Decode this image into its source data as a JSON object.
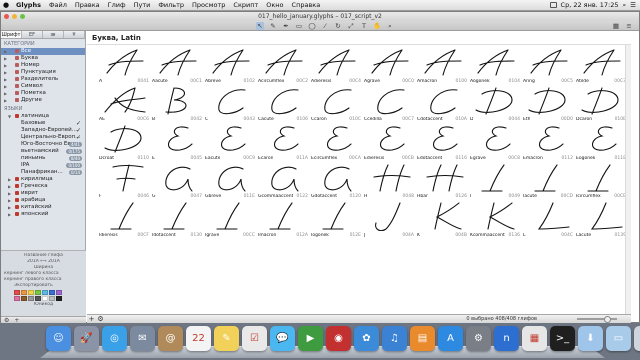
{
  "menubar": {
    "apple_icon": "apple-icon",
    "menus": [
      "Glyphs",
      "Файл",
      "Правка",
      "Глиф",
      "Пути",
      "Фильтр",
      "Просмотр",
      "Скрипт",
      "Окно",
      "Справка"
    ],
    "clock": "Ср, 22 янв. 17:25"
  },
  "window": {
    "title": "017_hello_january.glyphs – 017_script_v2",
    "toolbar_icons": [
      "pointer-tool",
      "draw-tool",
      "pen-tool",
      "rectangle-tool",
      "ellipse-tool",
      "knife-tool",
      "rotate-tool",
      "scale-tool",
      "text-tool",
      "hand-tool",
      "zoom-tool"
    ]
  },
  "sidebar": {
    "tabs": [
      "Шрифт",
      "ЕF",
      "ᴂ",
      "¥"
    ],
    "categories_heading": "КАТЕГОРИИ",
    "categories": [
      {
        "label": "Все",
        "selected": true
      },
      {
        "label": "Буква"
      },
      {
        "label": "Номер"
      },
      {
        "label": "Пунктуация"
      },
      {
        "label": "Разделитель"
      },
      {
        "label": "Символ"
      },
      {
        "label": "Пометка"
      },
      {
        "label": "Другие"
      }
    ],
    "languages_heading": "ЯЗЫКИ",
    "languages": [
      {
        "label": "латиница",
        "level": 1
      },
      {
        "label": "Базовые",
        "level": 2,
        "check": true
      },
      {
        "label": "Западно-Европей...",
        "level": 2,
        "check": true
      },
      {
        "label": "Центрально-Европ...",
        "level": 2,
        "check": true
      },
      {
        "label": "Юго-Восточно Евр...",
        "level": 2,
        "badge": "4/41"
      },
      {
        "label": "вьетнамский",
        "level": 2,
        "badge": "0/175"
      },
      {
        "label": "пиньинь",
        "level": 2,
        "badge": "8/40"
      },
      {
        "label": "IPA",
        "level": 2,
        "badge": "0/100"
      },
      {
        "label": "Панафрикан...",
        "level": 2,
        "badge": "0/14"
      },
      {
        "label": "кириллица",
        "level": 1
      },
      {
        "label": "Греческа",
        "level": 1
      },
      {
        "label": "иврит",
        "level": 1
      },
      {
        "label": "арабица",
        "level": 1
      },
      {
        "label": "китайский",
        "level": 1
      },
      {
        "label": "японский",
        "level": 1
      }
    ],
    "bottom": {
      "glyph_name_label": "Название глифа",
      "unicode_row": "201A ⟷ 201A",
      "width_label": "Ширина",
      "kerning_left": "кернинг левого класса",
      "kerning_right": "кернинг правого класса",
      "export_label": "Экспортировать",
      "note_label": "Юникод",
      "swatch_colors": [
        "#e54b4b",
        "#f0973a",
        "#f3d54a",
        "#7ac943",
        "#5fb9e5",
        "#3a6fd8",
        "#a066d3",
        "#e06ea8",
        "#8b5a2b",
        "#9a9a9a",
        "#555555",
        "#ffffff",
        "#c0c0c0",
        "#222222"
      ]
    }
  },
  "main": {
    "header": "Буква, Latin",
    "status": "0 выбрано 408/408 глифов",
    "glyphs": [
      {
        "name": "A",
        "code": "0041",
        "shape": "A"
      },
      {
        "name": "Aacute",
        "code": "00C1",
        "shape": "A"
      },
      {
        "name": "Abreve",
        "code": "0102",
        "shape": "A"
      },
      {
        "name": "Acircumflex",
        "code": "00C2",
        "shape": "A"
      },
      {
        "name": "Adieresis",
        "code": "00C4",
        "shape": "A"
      },
      {
        "name": "Agrave",
        "code": "00C0",
        "shape": "A"
      },
      {
        "name": "Amacron",
        "code": "0100",
        "shape": "A"
      },
      {
        "name": "Aogonek",
        "code": "0104",
        "shape": "A"
      },
      {
        "name": "Aring",
        "code": "00C5",
        "shape": "A"
      },
      {
        "name": "Atilde",
        "code": "00C3",
        "shape": "A"
      },
      {
        "name": "AE",
        "code": "00C6",
        "shape": "AE"
      },
      {
        "name": "B",
        "code": "0042",
        "shape": "B"
      },
      {
        "name": "C",
        "code": "0043",
        "shape": "C"
      },
      {
        "name": "Cacute",
        "code": "0106",
        "shape": "C"
      },
      {
        "name": "Ccaron",
        "code": "010C",
        "shape": "C"
      },
      {
        "name": "Ccedilla",
        "code": "00C7",
        "shape": "C"
      },
      {
        "name": "Cdotaccent",
        "code": "010A",
        "shape": "C"
      },
      {
        "name": "D",
        "code": "0044",
        "shape": "D"
      },
      {
        "name": "Eth",
        "code": "00D0",
        "shape": "D"
      },
      {
        "name": "Dcaron",
        "code": "010E",
        "shape": "D"
      },
      {
        "name": "Dcroat",
        "code": "0110",
        "shape": "D"
      },
      {
        "name": "E",
        "code": "0045",
        "shape": "E"
      },
      {
        "name": "Eacute",
        "code": "00C9",
        "shape": "E"
      },
      {
        "name": "Ecaron",
        "code": "011A",
        "shape": "E"
      },
      {
        "name": "Ecircumflex",
        "code": "00CA",
        "shape": "E"
      },
      {
        "name": "Edieresis",
        "code": "00CB",
        "shape": "E"
      },
      {
        "name": "Edotaccent",
        "code": "0116",
        "shape": "E"
      },
      {
        "name": "Egrave",
        "code": "00C8",
        "shape": "E"
      },
      {
        "name": "Emacron",
        "code": "0112",
        "shape": "E"
      },
      {
        "name": "Eogonek",
        "code": "0118",
        "shape": "E"
      },
      {
        "name": "F",
        "code": "0046",
        "shape": "F"
      },
      {
        "name": "G",
        "code": "0047",
        "shape": "G"
      },
      {
        "name": "Gbreve",
        "code": "011E",
        "shape": "G"
      },
      {
        "name": "Gcommaaccent",
        "code": "0122",
        "shape": "G"
      },
      {
        "name": "Gdotaccent",
        "code": "0120",
        "shape": "G"
      },
      {
        "name": "H",
        "code": "0048",
        "shape": "H"
      },
      {
        "name": "Hbar",
        "code": "0126",
        "shape": "H"
      },
      {
        "name": "I",
        "code": "0049",
        "shape": "I"
      },
      {
        "name": "Iacute",
        "code": "00CD",
        "shape": "I"
      },
      {
        "name": "Icircumflex",
        "code": "00CE",
        "shape": "I"
      },
      {
        "name": "Idieresis",
        "code": "00CF",
        "shape": "I"
      },
      {
        "name": "Idotaccent",
        "code": "0130",
        "shape": "I"
      },
      {
        "name": "Igrave",
        "code": "00CC",
        "shape": "I"
      },
      {
        "name": "Imacron",
        "code": "012A",
        "shape": "I"
      },
      {
        "name": "Iogonek",
        "code": "012E",
        "shape": "I"
      },
      {
        "name": "J",
        "code": "004A",
        "shape": "J"
      },
      {
        "name": "K",
        "code": "004B",
        "shape": "K"
      },
      {
        "name": "Kcommaaccent",
        "code": "0136",
        "shape": "K"
      },
      {
        "name": "L",
        "code": "004C",
        "shape": "L"
      },
      {
        "name": "Lacute",
        "code": "0139",
        "shape": "L"
      }
    ]
  },
  "dock": {
    "icons": [
      {
        "name": "finder-icon",
        "color": "#4a8fe0",
        "glyph": "☺"
      },
      {
        "name": "launchpad-icon",
        "color": "#8a94a6",
        "glyph": "🚀"
      },
      {
        "name": "safari-icon",
        "color": "#3aa0e8",
        "glyph": "◎"
      },
      {
        "name": "mail-icon",
        "color": "#7c8aa0",
        "glyph": "✉"
      },
      {
        "name": "contacts-icon",
        "color": "#b08a5a",
        "glyph": "@"
      },
      {
        "name": "calendar-icon",
        "color": "#f4f4f4",
        "glyph": "22"
      },
      {
        "name": "notes-icon",
        "color": "#f2d15a",
        "glyph": "✎"
      },
      {
        "name": "reminders-icon",
        "color": "#e9e9e9",
        "glyph": "☑"
      },
      {
        "name": "messages-icon",
        "color": "#4bb7f0",
        "glyph": "💬"
      },
      {
        "name": "facetime-icon",
        "color": "#3f9b3f",
        "glyph": "▶"
      },
      {
        "name": "photobooth-icon",
        "color": "#c23030",
        "glyph": "◉"
      },
      {
        "name": "photos-icon",
        "color": "#3c8bd9",
        "glyph": "✿"
      },
      {
        "name": "itunes-icon",
        "color": "#3b82d4",
        "glyph": "♫"
      },
      {
        "name": "ibooks-icon",
        "color": "#e98a2c",
        "glyph": "▤"
      },
      {
        "name": "appstore-icon",
        "color": "#2e8ae0",
        "glyph": "A"
      },
      {
        "name": "preferences-icon",
        "color": "#7a7f87",
        "glyph": "⚙"
      },
      {
        "name": "glyphs-app-icon",
        "color": "#2d6fd0",
        "glyph": "n"
      },
      {
        "name": "preview-icon",
        "color": "#e6e6e6",
        "glyph": "▦"
      },
      {
        "name": "terminal-icon",
        "color": "#1f1f1f",
        "glyph": ">_"
      },
      {
        "name": "downloads-folder-icon",
        "color": "#9fc6ea",
        "glyph": "⬇"
      },
      {
        "name": "documents-folder-icon",
        "color": "#a9cbea",
        "glyph": "▭"
      },
      {
        "name": "trash-icon",
        "color": "#cfd5dc",
        "glyph": "🗑"
      }
    ]
  }
}
